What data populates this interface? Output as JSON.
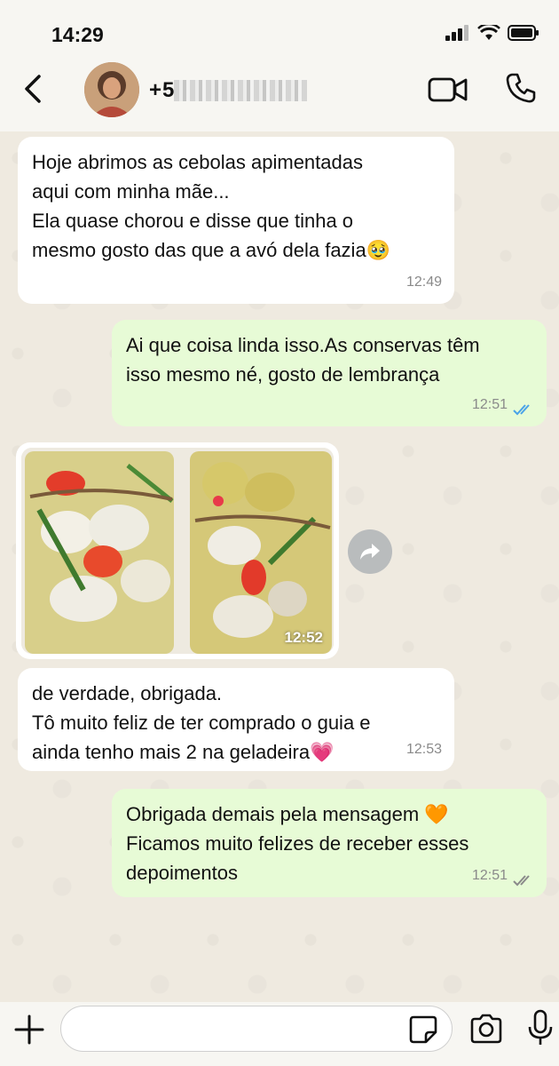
{
  "status_bar": {
    "time": "14:29"
  },
  "header": {
    "contact_name": "+5"
  },
  "messages": [
    {
      "direction": "incoming",
      "text": "Hoje abrimos as cebolas apimentadas\naqui com minha mãe...\nEla quase chorou e disse que tinha o\nmesmo gosto das que a avó dela fazia🥹",
      "time": "12:49"
    },
    {
      "direction": "outgoing",
      "text": "Ai que coisa linda isso.As conservas têm\nisso mesmo né, gosto de lembrança",
      "time": "12:51",
      "ticks": "read"
    },
    {
      "direction": "incoming",
      "type": "photo",
      "time": "12:52"
    },
    {
      "direction": "incoming",
      "text": "de verdade, obrigada.\nTô muito feliz de ter comprado o guia e\nainda tenho mais 2 na geladeira💗",
      "time": "12:53"
    },
    {
      "direction": "outgoing",
      "text": "Obrigada demais pela mensagem 🧡\nFicamos muito felizes de receber esses\ndepoimentos",
      "time": "12:51",
      "ticks": "delivered"
    }
  ],
  "input": {
    "placeholder": ""
  },
  "colors": {
    "outgoing_bubble": "#e7fbd6",
    "incoming_bubble": "#ffffff",
    "read_ticks": "#4aa3e8",
    "delivered_ticks": "#8a8a8a"
  },
  "icons": [
    "back-arrow-icon",
    "video-call-icon",
    "phone-icon",
    "forward-icon",
    "plus-icon",
    "sticker-icon",
    "camera-icon",
    "microphone-icon"
  ]
}
